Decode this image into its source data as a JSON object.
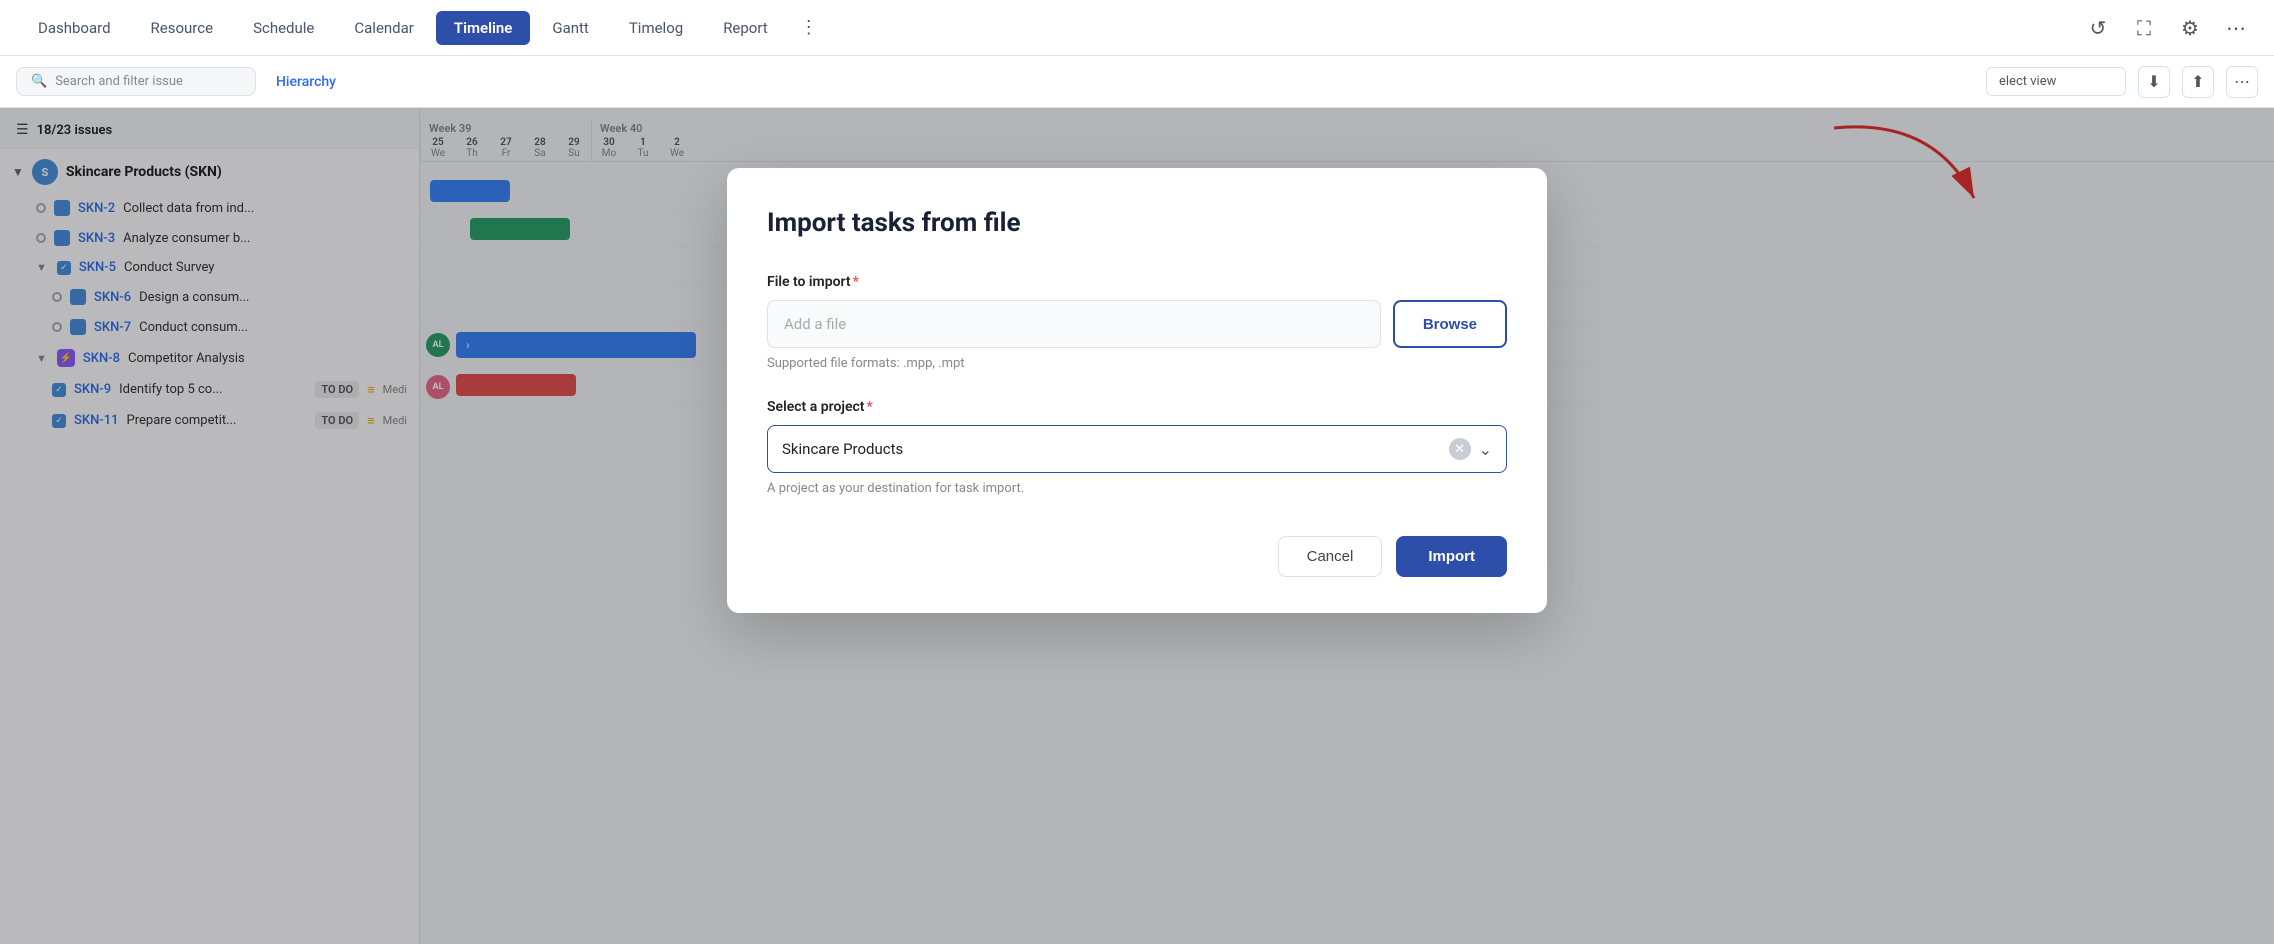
{
  "nav": {
    "items": [
      {
        "label": "Dashboard",
        "active": false
      },
      {
        "label": "Resource",
        "active": false
      },
      {
        "label": "Schedule",
        "active": false
      },
      {
        "label": "Calendar",
        "active": false
      },
      {
        "label": "Timeline",
        "active": true
      },
      {
        "label": "Gantt",
        "active": false
      },
      {
        "label": "Timelog",
        "active": false
      },
      {
        "label": "Report",
        "active": false
      }
    ],
    "more_label": "⋮"
  },
  "second_nav": {
    "search_placeholder": "Search and filter issue",
    "hierarchy_label": "Hierarchy",
    "select_view_placeholder": "elect view"
  },
  "issues": {
    "count_label": "18/23 issues",
    "project": {
      "name": "Skincare Products (SKN)",
      "icon": "S"
    },
    "rows": [
      {
        "id": "SKN-2",
        "title": "Collect data from ind...",
        "dot": "empty",
        "badge": null
      },
      {
        "id": "SKN-3",
        "title": "Analyze consumer b...",
        "dot": "empty",
        "badge": null
      },
      {
        "id": "SKN-5",
        "title": "Conduct Survey",
        "dot": "checked",
        "badge": null,
        "has_chevron": true
      },
      {
        "id": "SKN-6",
        "title": "Design a consum...",
        "dot": "empty",
        "badge": null,
        "indent": true
      },
      {
        "id": "SKN-7",
        "title": "Conduct consum...",
        "dot": "empty",
        "badge": null,
        "indent": true
      },
      {
        "id": "SKN-8",
        "title": "Competitor Analysis",
        "dot": "purple",
        "badge": null,
        "has_chevron": true
      },
      {
        "id": "SKN-9",
        "title": "Identify top 5 co...",
        "dot": "checked",
        "badge": "TO DO",
        "priority": "medium",
        "indent": true
      },
      {
        "id": "SKN-11",
        "title": "Prepare competit...",
        "dot": "checked",
        "badge": "TO DO",
        "priority": "medium",
        "indent": true
      }
    ]
  },
  "timeline": {
    "weeks": [
      {
        "label": "Week 39",
        "days": [
          {
            "name": "We",
            "num": "25"
          },
          {
            "name": "Th",
            "num": "26"
          },
          {
            "name": "Fr",
            "num": "27"
          },
          {
            "name": "Sa",
            "num": "28"
          },
          {
            "name": "Su",
            "num": "29"
          }
        ]
      },
      {
        "label": "Week 40",
        "days": [
          {
            "name": "Mo",
            "num": "30"
          },
          {
            "name": "Tu",
            "num": "1"
          },
          {
            "name": "We",
            "num": "2"
          }
        ]
      }
    ]
  },
  "modal": {
    "title": "Import tasks from file",
    "file_label": "File to import",
    "file_placeholder": "Add a file",
    "browse_label": "Browse",
    "file_hint": "Supported file formats: .mpp, .mpt",
    "project_label": "Select a project",
    "project_value": "Skincare Products",
    "project_hint": "A project as your destination for task import.",
    "cancel_label": "Cancel",
    "import_label": "Import"
  }
}
